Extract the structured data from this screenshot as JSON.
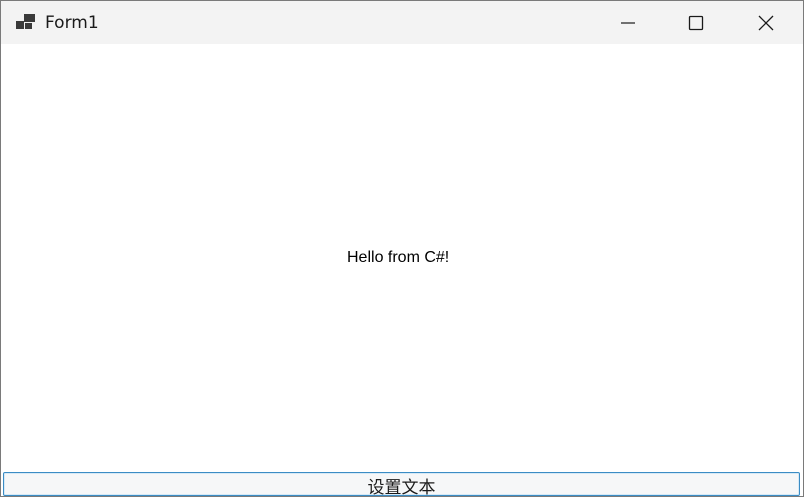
{
  "window": {
    "title": "Form1",
    "icon": "windows-forms-app-icon",
    "controls": {
      "minimize_icon": "minimize-icon",
      "maximize_icon": "maximize-icon",
      "close_icon": "close-icon"
    }
  },
  "form": {
    "label_text": "Hello from C#!",
    "button_label": "设置文本"
  },
  "colors": {
    "titlebar_bg": "#f3f3f3",
    "client_bg": "#ffffff",
    "button_border": "#3b8cc4"
  }
}
